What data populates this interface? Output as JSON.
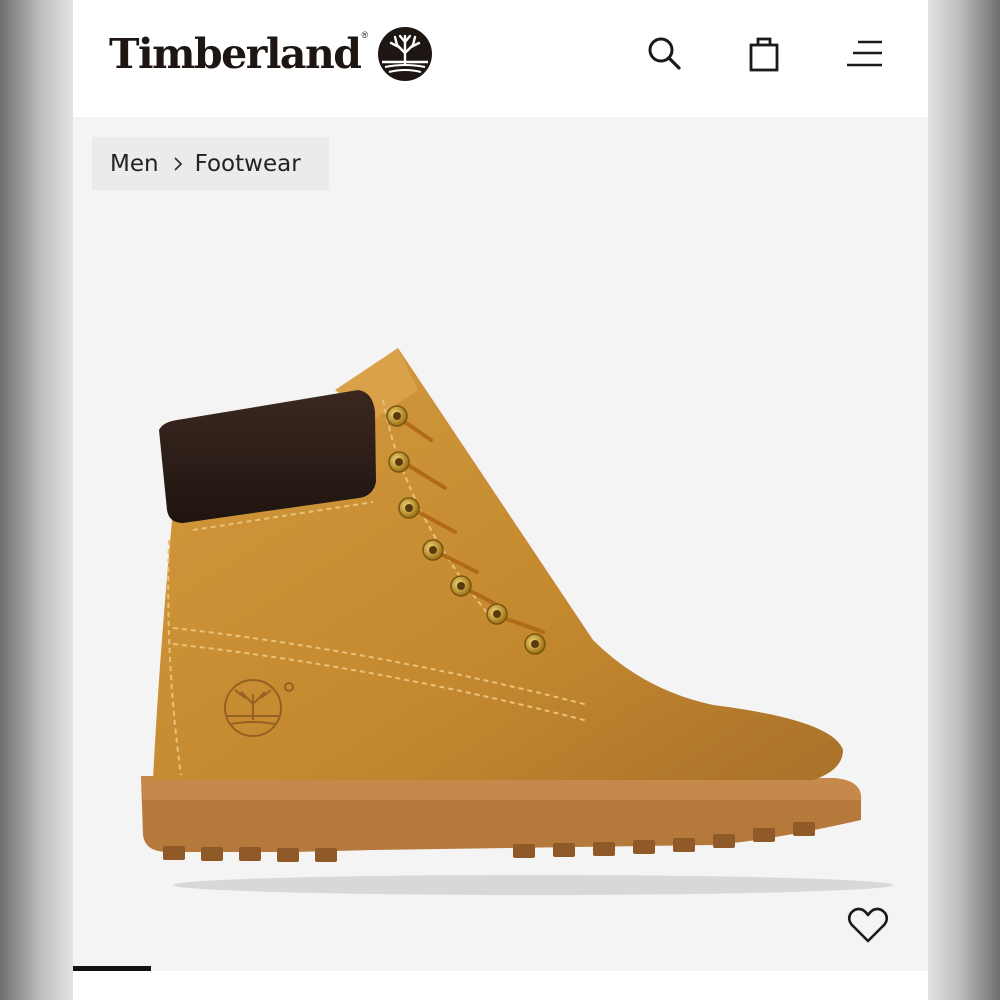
{
  "header": {
    "brand": "Timberland",
    "registered_mark": "®",
    "icons": [
      "search-icon",
      "shopping-bag-icon",
      "menu-icon"
    ]
  },
  "breadcrumb": {
    "items": [
      "Men",
      "Footwear"
    ],
    "separator_icon": "chevron-right-icon"
  },
  "product": {
    "image": "wheat-nubuck-6-inch-boot",
    "wishlist_icon": "heart-outline-icon"
  },
  "colors": {
    "header_bg": "#ffffff",
    "page_bg": "#f4f4f4",
    "brand_text": "#1e1612",
    "boot_wheat": "#c4892f",
    "collar_brown": "#2c1d16",
    "sole_tan": "#b5793c"
  },
  "carousel": {
    "slide_indicator_position": 1
  }
}
